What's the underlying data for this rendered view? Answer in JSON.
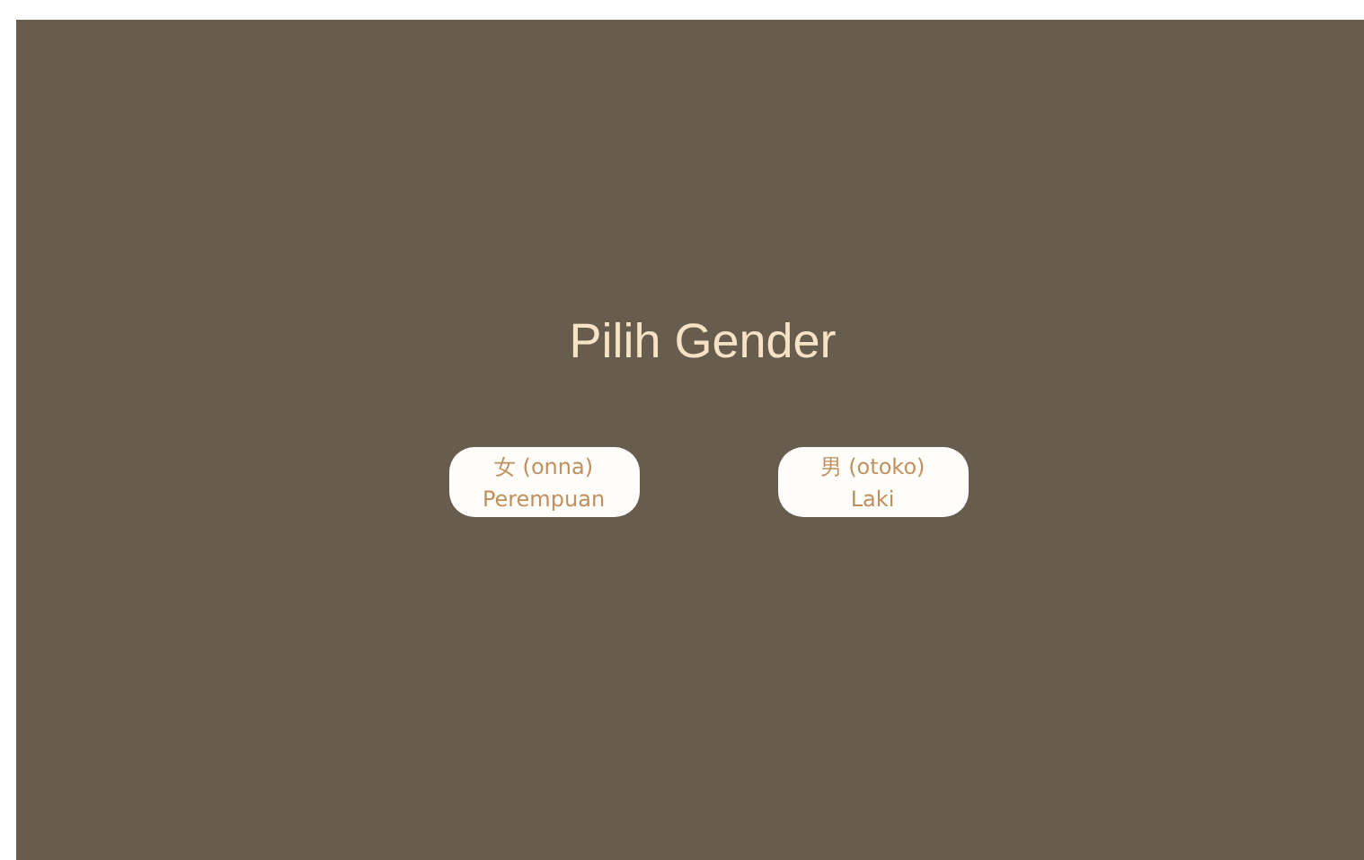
{
  "title": "Pilih Gender",
  "options": [
    {
      "label": "女 (onna)",
      "sublabel": "Perempuan"
    },
    {
      "label": "男 (otoko)",
      "sublabel": "Laki"
    }
  ]
}
